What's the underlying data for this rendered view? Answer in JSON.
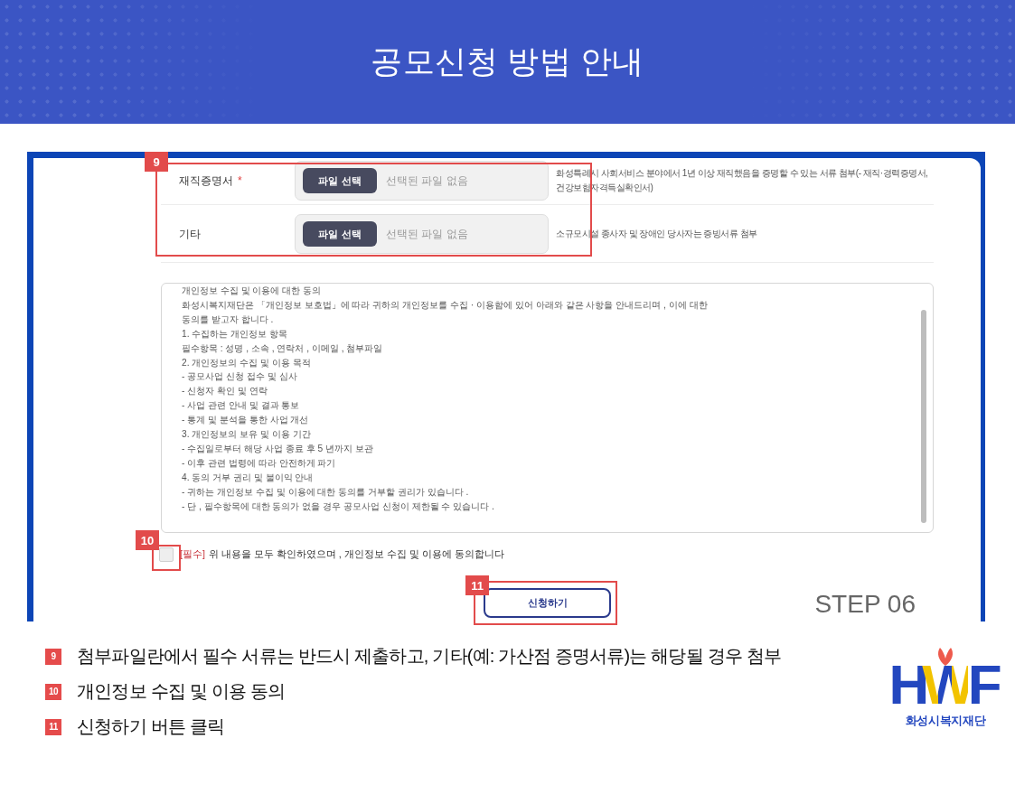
{
  "header": {
    "title": "공모신청 방법 안내"
  },
  "form": {
    "file_rows": [
      {
        "label": "재직증명서",
        "required_mark": "*",
        "button": "파일 선택",
        "placeholder": "선택된 파일 없음",
        "description": "화성특례시 사회서비스 분야에서 1년 이상 재직했음을 증명할 수 있는 서류 첨부(- 재직·경력증명서, 건강보험자격득실확인서)"
      },
      {
        "label": "기타",
        "button": "파일 선택",
        "placeholder": "선택된 파일 없음",
        "description": "소규모시설 종사자 및 장애인 당사자는 증빙서류 첨부"
      }
    ],
    "consent": {
      "lines": [
        "개인정보 수집 및 이용에 대한 동의",
        "화성시복지재단은 「개인정보 보호법」에 따라 귀하의 개인정보를 수집 · 이용함에 있어 아래와 같은 사항을 안내드리며 , 이에 대한",
        "동의를 받고자 합니다 .",
        "1. 수집하는 개인정보 항목",
        "필수항목 : 성명 , 소속 , 연락처 , 이메일 , 첨부파일",
        "2. 개인정보의 수집 및 이용 목적",
        "- 공모사업 신청 접수 및 심사",
        "- 신청자 확인 및 연락",
        "- 사업 관련 안내 및 결과 통보",
        "- 통계 및 분석을 통한 사업 개선",
        "3. 개인정보의 보유 및 이용 기간",
        "- 수집일로부터 해당 사업 종료 후 5 년까지 보관",
        "- 이후 관련 법령에 따라 안전하게 파기",
        "4. 동의 거부 권리 및 불이익 안내",
        "- 귀하는 개인정보 수집 및 이용에 대한 동의를 거부할 권리가 있습니다 .",
        "- 단 , 필수항목에 대한 동의가 없을 경우 공모사업 신청이 제한될 수 있습니다 ."
      ],
      "checked": false,
      "required_tag": "[필수]",
      "label": "위 내용을 모두 확인하였으며 , 개인정보 수집 및 이용에 동의합니다"
    },
    "submit_button": "신청하기",
    "step_label": "STEP 06"
  },
  "annotations": [
    {
      "number": "9"
    },
    {
      "number": "10"
    },
    {
      "number": "11"
    }
  ],
  "instructions": [
    {
      "number": "9",
      "text": "첨부파일란에서 필수 서류는 반드시 제출하고, 기타(예: 가산점 증명서류)는 해당될 경우 첨부"
    },
    {
      "number": "10",
      "text": "개인정보 수집 및 이용 동의"
    },
    {
      "number": "11",
      "text": "신청하기 버튼 클릭"
    }
  ],
  "logo": {
    "mark": "HWF",
    "name": "화성시복지재단"
  }
}
